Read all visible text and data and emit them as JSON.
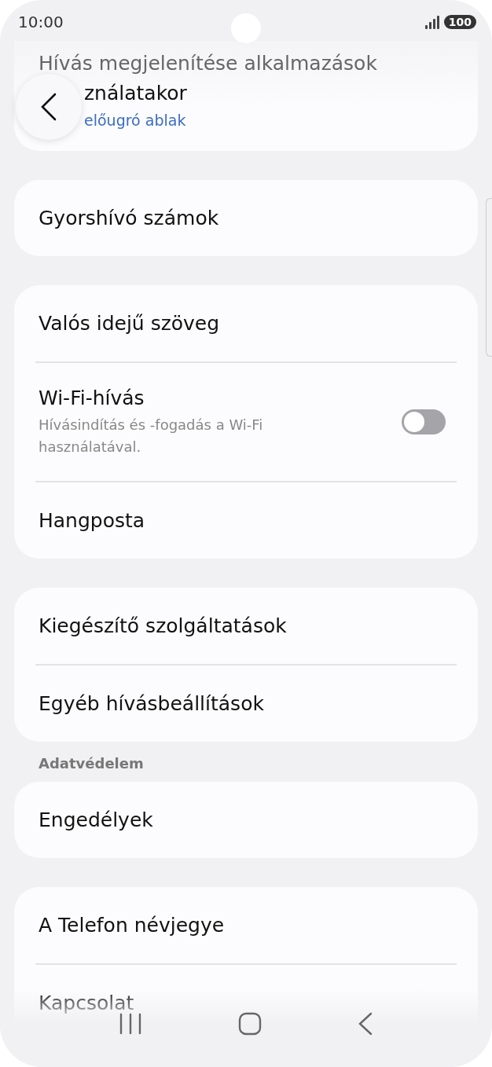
{
  "status_bar": {
    "time": "10:00",
    "battery": "100"
  },
  "top_card": {
    "title_lines": [
      "Hívás megjelenítése alkalmazások",
      "ználatakor"
    ],
    "summary": "előugró ablak"
  },
  "groups": [
    {
      "items": [
        {
          "kind": "plain",
          "title": "Gyorshívó számok"
        }
      ]
    },
    {
      "items": [
        {
          "kind": "plain",
          "title": "Valós idejű szöveg"
        },
        {
          "kind": "switch",
          "title": "Wi-Fi-hívás",
          "summary": "Hívásindítás és -fogadás a Wi-Fi használatával.",
          "on": false
        },
        {
          "kind": "plain",
          "title": "Hangposta"
        }
      ]
    },
    {
      "items": [
        {
          "kind": "plain",
          "title": "Kiegészítő szolgáltatások"
        },
        {
          "kind": "plain",
          "title": "Egyéb hívásbeállítások"
        }
      ]
    },
    {
      "header": "Adatvédelem",
      "items": [
        {
          "kind": "plain",
          "title": "Engedélyek"
        }
      ]
    },
    {
      "items": [
        {
          "kind": "plain",
          "title": "A Telefon névjegye"
        },
        {
          "kind": "plain",
          "title": "Kapcsolat"
        }
      ]
    }
  ]
}
